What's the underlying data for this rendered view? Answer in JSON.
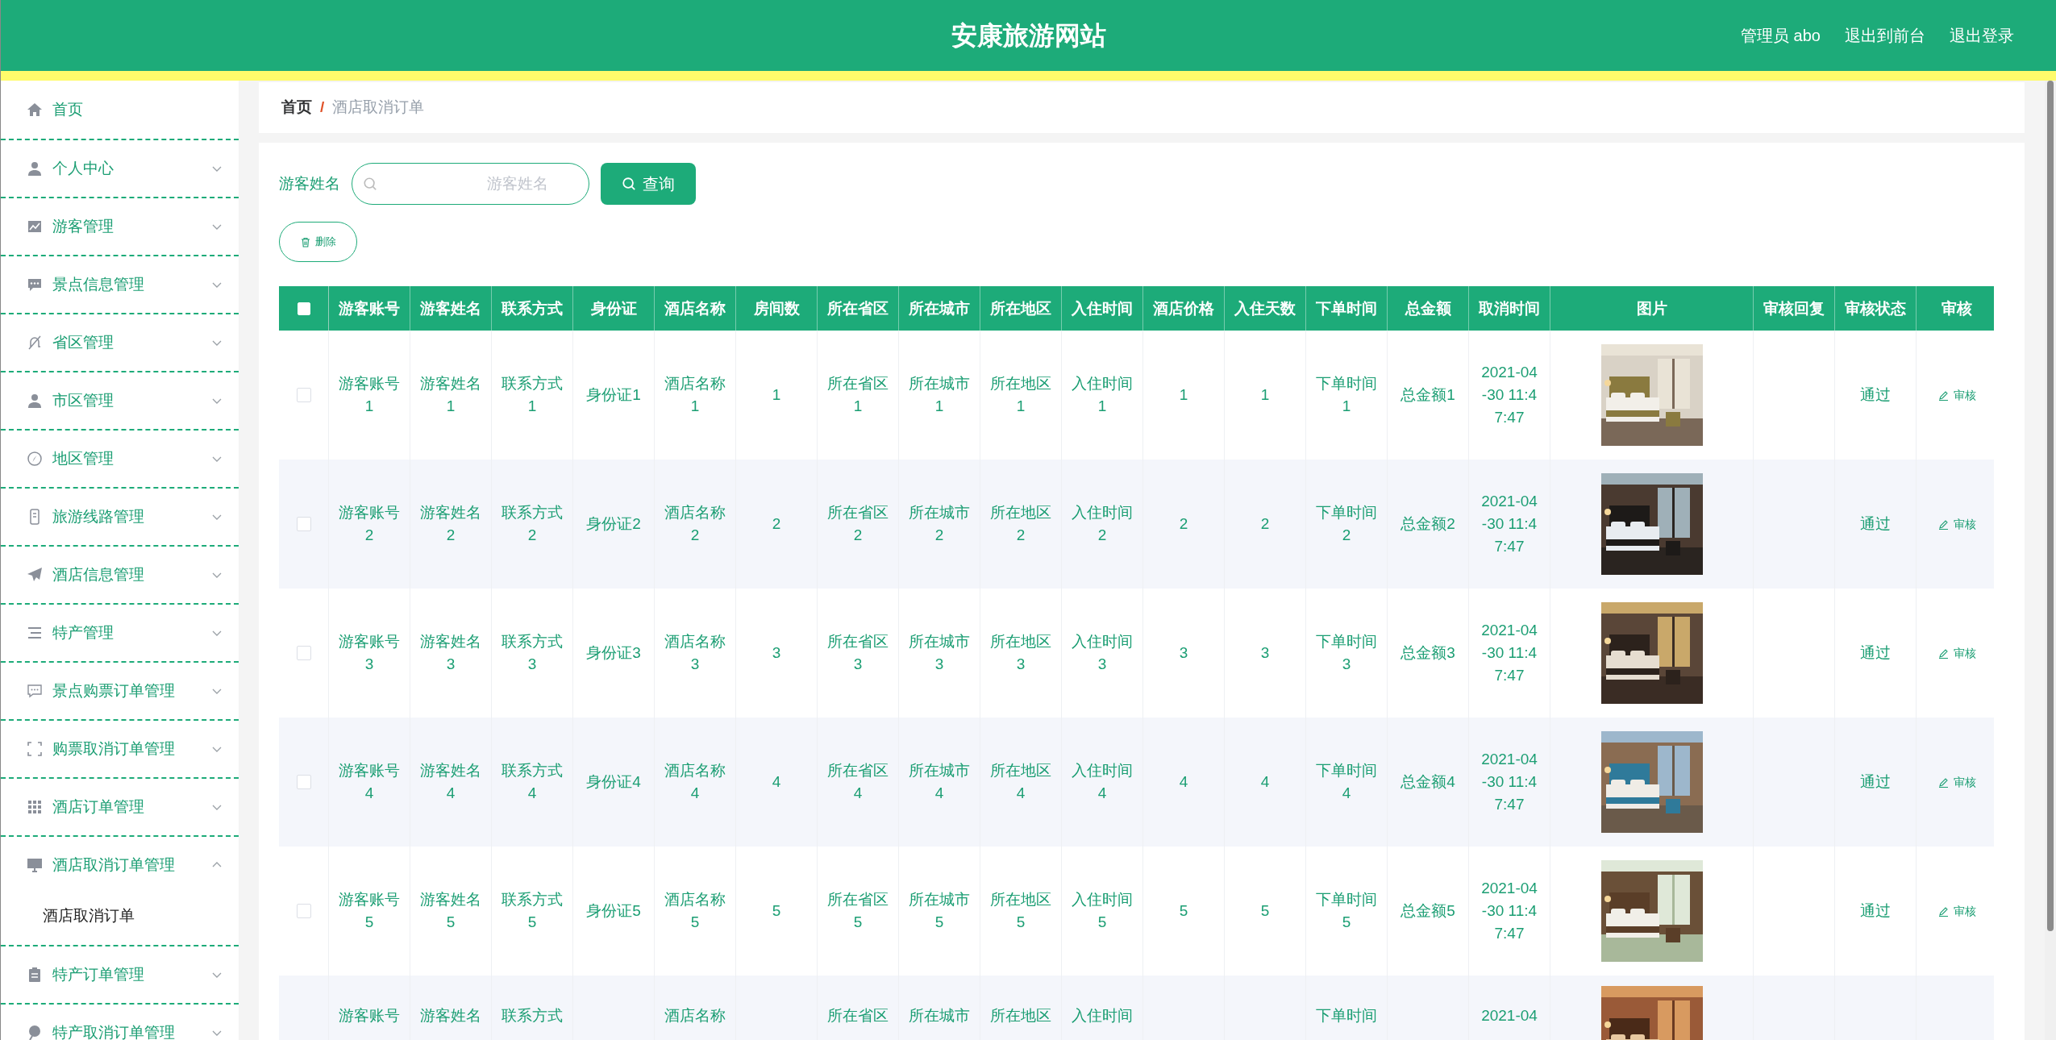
{
  "header": {
    "title": "安康旅游网站",
    "links": [
      "管理员 abo",
      "退出到前台",
      "退出登录"
    ]
  },
  "sidebar": {
    "items": [
      {
        "label": "首页",
        "expandable": false
      },
      {
        "label": "个人中心",
        "expandable": true,
        "expanded": false
      },
      {
        "label": "游客管理",
        "expandable": true,
        "expanded": false
      },
      {
        "label": "景点信息管理",
        "expandable": true,
        "expanded": false
      },
      {
        "label": "省区管理",
        "expandable": true,
        "expanded": false
      },
      {
        "label": "市区管理",
        "expandable": true,
        "expanded": false
      },
      {
        "label": "地区管理",
        "expandable": true,
        "expanded": false
      },
      {
        "label": "旅游线路管理",
        "expandable": true,
        "expanded": false
      },
      {
        "label": "酒店信息管理",
        "expandable": true,
        "expanded": false
      },
      {
        "label": "特产管理",
        "expandable": true,
        "expanded": false
      },
      {
        "label": "景点购票订单管理",
        "expandable": true,
        "expanded": false
      },
      {
        "label": "购票取消订单管理",
        "expandable": true,
        "expanded": false
      },
      {
        "label": "酒店订单管理",
        "expandable": true,
        "expanded": false
      },
      {
        "label": "酒店取消订单管理",
        "expandable": true,
        "expanded": true,
        "children": [
          {
            "label": "酒店取消订单"
          }
        ]
      },
      {
        "label": "特产订单管理",
        "expandable": true,
        "expanded": false
      },
      {
        "label": "特产取消订单管理",
        "expandable": true,
        "expanded": false
      }
    ]
  },
  "breadcrumb": [
    "首页",
    "/",
    "酒店取消订单"
  ],
  "search": {
    "label": "游客姓名",
    "placeholder": "游客姓名",
    "button": "查询"
  },
  "delete_button": "删除",
  "table": {
    "all_checked": false,
    "columns": [
      "游客账号",
      "游客姓名",
      "联系方式",
      "身份证",
      "酒店名称",
      "房间数",
      "所在省区",
      "所在城市",
      "所在地区",
      "入住时间",
      "酒店价格",
      "入住天数",
      "下单时间",
      "总金额",
      "取消时间",
      "图片",
      "审核回复",
      "审核状态",
      "审核"
    ],
    "rows": [
      {
        "kind": "full",
        "checked": false,
        "account": "游客账号1",
        "name": "游客姓名1",
        "phone": "联系方式1",
        "id_card": "身份证1",
        "hotel": "酒店名称1",
        "rooms": "1",
        "province": "所在省区1",
        "city": "所在城市1",
        "district": "所在地区1",
        "checkin": "入住时间1",
        "price": "1",
        "days": "1",
        "order_time": "下单时间1",
        "total": "总金额1",
        "cancel_time": "2021-04-30 11:47:47",
        "status": "通过",
        "action": "审核"
      },
      {
        "kind": "full",
        "checked": false,
        "account": "游客账号2",
        "name": "游客姓名2",
        "phone": "联系方式2",
        "id_card": "身份证2",
        "hotel": "酒店名称2",
        "rooms": "2",
        "province": "所在省区2",
        "city": "所在城市2",
        "district": "所在地区2",
        "checkin": "入住时间2",
        "price": "2",
        "days": "2",
        "order_time": "下单时间2",
        "total": "总金额2",
        "cancel_time": "2021-04-30 11:47:47",
        "status": "通过",
        "action": "审核"
      },
      {
        "kind": "full",
        "checked": false,
        "account": "游客账号3",
        "name": "游客姓名3",
        "phone": "联系方式3",
        "id_card": "身份证3",
        "hotel": "酒店名称3",
        "rooms": "3",
        "province": "所在省区3",
        "city": "所在城市3",
        "district": "所在地区3",
        "checkin": "入住时间3",
        "price": "3",
        "days": "3",
        "order_time": "下单时间3",
        "total": "总金额3",
        "cancel_time": "2021-04-30 11:47:47",
        "status": "通过",
        "action": "审核"
      },
      {
        "kind": "full",
        "checked": false,
        "account": "游客账号4",
        "name": "游客姓名4",
        "phone": "联系方式4",
        "id_card": "身份证4",
        "hotel": "酒店名称4",
        "rooms": "4",
        "province": "所在省区4",
        "city": "所在城市4",
        "district": "所在地区4",
        "checkin": "入住时间4",
        "price": "4",
        "days": "4",
        "order_time": "下单时间4",
        "total": "总金额4",
        "cancel_time": "2021-04-30 11:47:47",
        "status": "通过",
        "action": "审核"
      },
      {
        "kind": "full",
        "checked": false,
        "account": "游客账号5",
        "name": "游客姓名5",
        "phone": "联系方式5",
        "id_card": "身份证5",
        "hotel": "酒店名称5",
        "rooms": "5",
        "province": "所在省区5",
        "city": "所在城市5",
        "district": "所在地区5",
        "checkin": "入住时间5",
        "price": "5",
        "days": "5",
        "order_time": "下单时间5",
        "total": "总金额5",
        "cancel_time": "2021-04-30 11:47:47",
        "status": "通过",
        "action": "审核"
      },
      {
        "kind": "cut",
        "account": "游客账号",
        "name": "游客姓名",
        "phone": "联系方式",
        "hotel": "酒店名称",
        "province": "所在省区",
        "city": "所在城市",
        "district": "所在地区",
        "checkin": "入住时间",
        "order_time": "下单时间",
        "cancel_time": "2021-04"
      }
    ]
  }
}
